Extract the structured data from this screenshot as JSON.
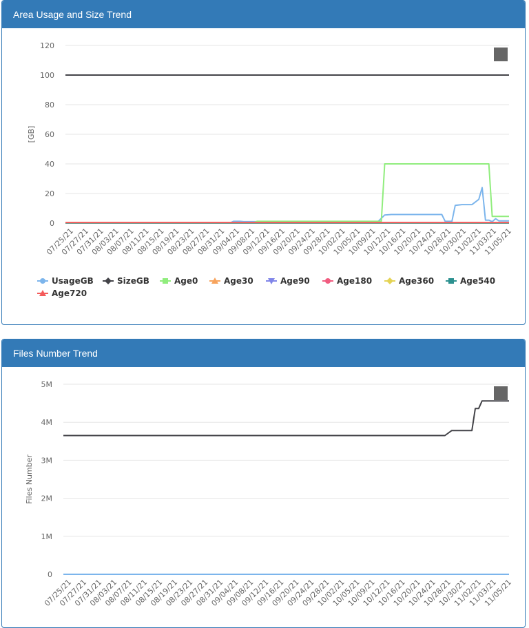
{
  "panels": [
    {
      "title": "Area Usage and Size Trend"
    },
    {
      "title": "Files Number Trend"
    }
  ],
  "chart_data": [
    {
      "type": "line",
      "ylabel": "[GB]",
      "ylim": [
        0,
        120
      ],
      "yticks": [
        "0",
        "20",
        "40",
        "60",
        "80",
        "100",
        "120"
      ],
      "ytick_values": [
        0,
        20,
        40,
        60,
        80,
        100,
        120
      ],
      "x_labels": [
        "07/25/21",
        "07/27/21",
        "07/31/21",
        "08/03/21",
        "08/07/21",
        "08/11/21",
        "08/15/21",
        "08/19/21",
        "08/23/21",
        "08/27/21",
        "08/31/21",
        "09/04/21",
        "09/08/21",
        "09/12/21",
        "09/16/21",
        "09/20/21",
        "09/24/21",
        "09/28/21",
        "10/02/21",
        "10/05/21",
        "10/09/21",
        "10/12/21",
        "10/16/21",
        "10/20/21",
        "10/24/21",
        "10/28/21",
        "10/30/21",
        "11/02/21",
        "11/03/21",
        "11/05/21"
      ],
      "grid": true,
      "legend": "bottom",
      "menu_icon": "hamburger-menu-icon",
      "series": [
        {
          "name": "UsageGB",
          "color": "#7cb5ec",
          "marker": "circle",
          "points": [
            [
              0,
              0.2
            ],
            [
              49,
              0.2
            ],
            [
              50,
              1.2
            ],
            [
              52,
              1.2
            ],
            [
              53,
              1.0
            ],
            [
              93,
              1.0
            ],
            [
              95,
              5.5
            ],
            [
              97,
              5.8
            ],
            [
              112,
              5.8
            ],
            [
              113,
              1.2
            ],
            [
              115,
              1.2
            ],
            [
              116,
              12
            ],
            [
              118,
              12.5
            ],
            [
              121,
              12.5
            ],
            [
              123,
              16
            ],
            [
              124,
              24
            ],
            [
              125,
              2
            ],
            [
              126,
              2
            ],
            [
              127,
              1
            ],
            [
              128,
              3
            ],
            [
              129,
              1.5
            ],
            [
              132,
              1.5
            ]
          ]
        },
        {
          "name": "SizeGB",
          "color": "#434348",
          "marker": "diamond",
          "points": [
            [
              0,
              100
            ],
            [
              132,
              100
            ]
          ]
        },
        {
          "name": "Age0",
          "color": "#90ed7d",
          "marker": "square",
          "points": [
            [
              0,
              0.3
            ],
            [
              56,
              0.3
            ],
            [
              57,
              1.2
            ],
            [
              94,
              1.2
            ],
            [
              95,
              40
            ],
            [
              126,
              40
            ],
            [
              127,
              4.5
            ],
            [
              132,
              4.5
            ]
          ]
        },
        {
          "name": "Age30",
          "color": "#f7a35c",
          "marker": "triangle",
          "points": [
            [
              0,
              0.3
            ],
            [
              132,
              0.3
            ]
          ]
        },
        {
          "name": "Age90",
          "color": "#8085e9",
          "marker": "triangle-down",
          "points": [
            [
              0,
              0.1
            ],
            [
              132,
              0.1
            ]
          ]
        },
        {
          "name": "Age180",
          "color": "#f15c80",
          "marker": "circle",
          "points": [
            [
              0,
              0.2
            ],
            [
              132,
              0.2
            ]
          ]
        },
        {
          "name": "Age360",
          "color": "#e4d354",
          "marker": "diamond",
          "points": [
            [
              0,
              0.1
            ],
            [
              132,
              0.1
            ]
          ]
        },
        {
          "name": "Age540",
          "color": "#2b908f",
          "marker": "square",
          "points": [
            [
              0,
              0.1
            ],
            [
              132,
              0.1
            ]
          ]
        },
        {
          "name": "Age720",
          "color": "#f45b5b",
          "marker": "triangle",
          "points": [
            [
              0,
              0.4
            ],
            [
              132,
              0.4
            ]
          ]
        }
      ]
    },
    {
      "type": "line",
      "ylabel": "Files Number",
      "ylim": [
        0,
        5000000
      ],
      "yticks": [
        "0",
        "1M",
        "2M",
        "3M",
        "4M",
        "5M"
      ],
      "ytick_values": [
        0,
        1000000,
        2000000,
        3000000,
        4000000,
        5000000
      ],
      "x_labels": [
        "07/25/21",
        "07/27/21",
        "07/31/21",
        "08/03/21",
        "08/07/21",
        "08/11/21",
        "08/15/21",
        "08/19/21",
        "08/23/21",
        "08/27/21",
        "08/31/21",
        "09/04/21",
        "09/08/21",
        "09/12/21",
        "09/16/21",
        "09/20/21",
        "09/24/21",
        "09/28/21",
        "10/02/21",
        "10/05/21",
        "10/09/21",
        "10/12/21",
        "10/16/21",
        "10/20/21",
        "10/24/21",
        "10/28/21",
        "10/30/21",
        "11/02/21",
        "11/03/21",
        "11/05/21"
      ],
      "grid": true,
      "legend": "none",
      "menu_icon": "hamburger-menu-icon",
      "series": [
        {
          "color": "#434348",
          "points": [
            [
              0,
              3650000
            ],
            [
              113,
              3650000
            ],
            [
              115,
              3780000
            ],
            [
              121,
              3780000
            ],
            [
              122,
              4360000
            ],
            [
              123,
              4360000
            ],
            [
              124,
              4560000
            ],
            [
              132,
              4560000
            ]
          ]
        },
        {
          "color": "#7cb5ec",
          "points": [
            [
              0,
              0
            ],
            [
              132,
              0
            ]
          ]
        }
      ]
    }
  ]
}
